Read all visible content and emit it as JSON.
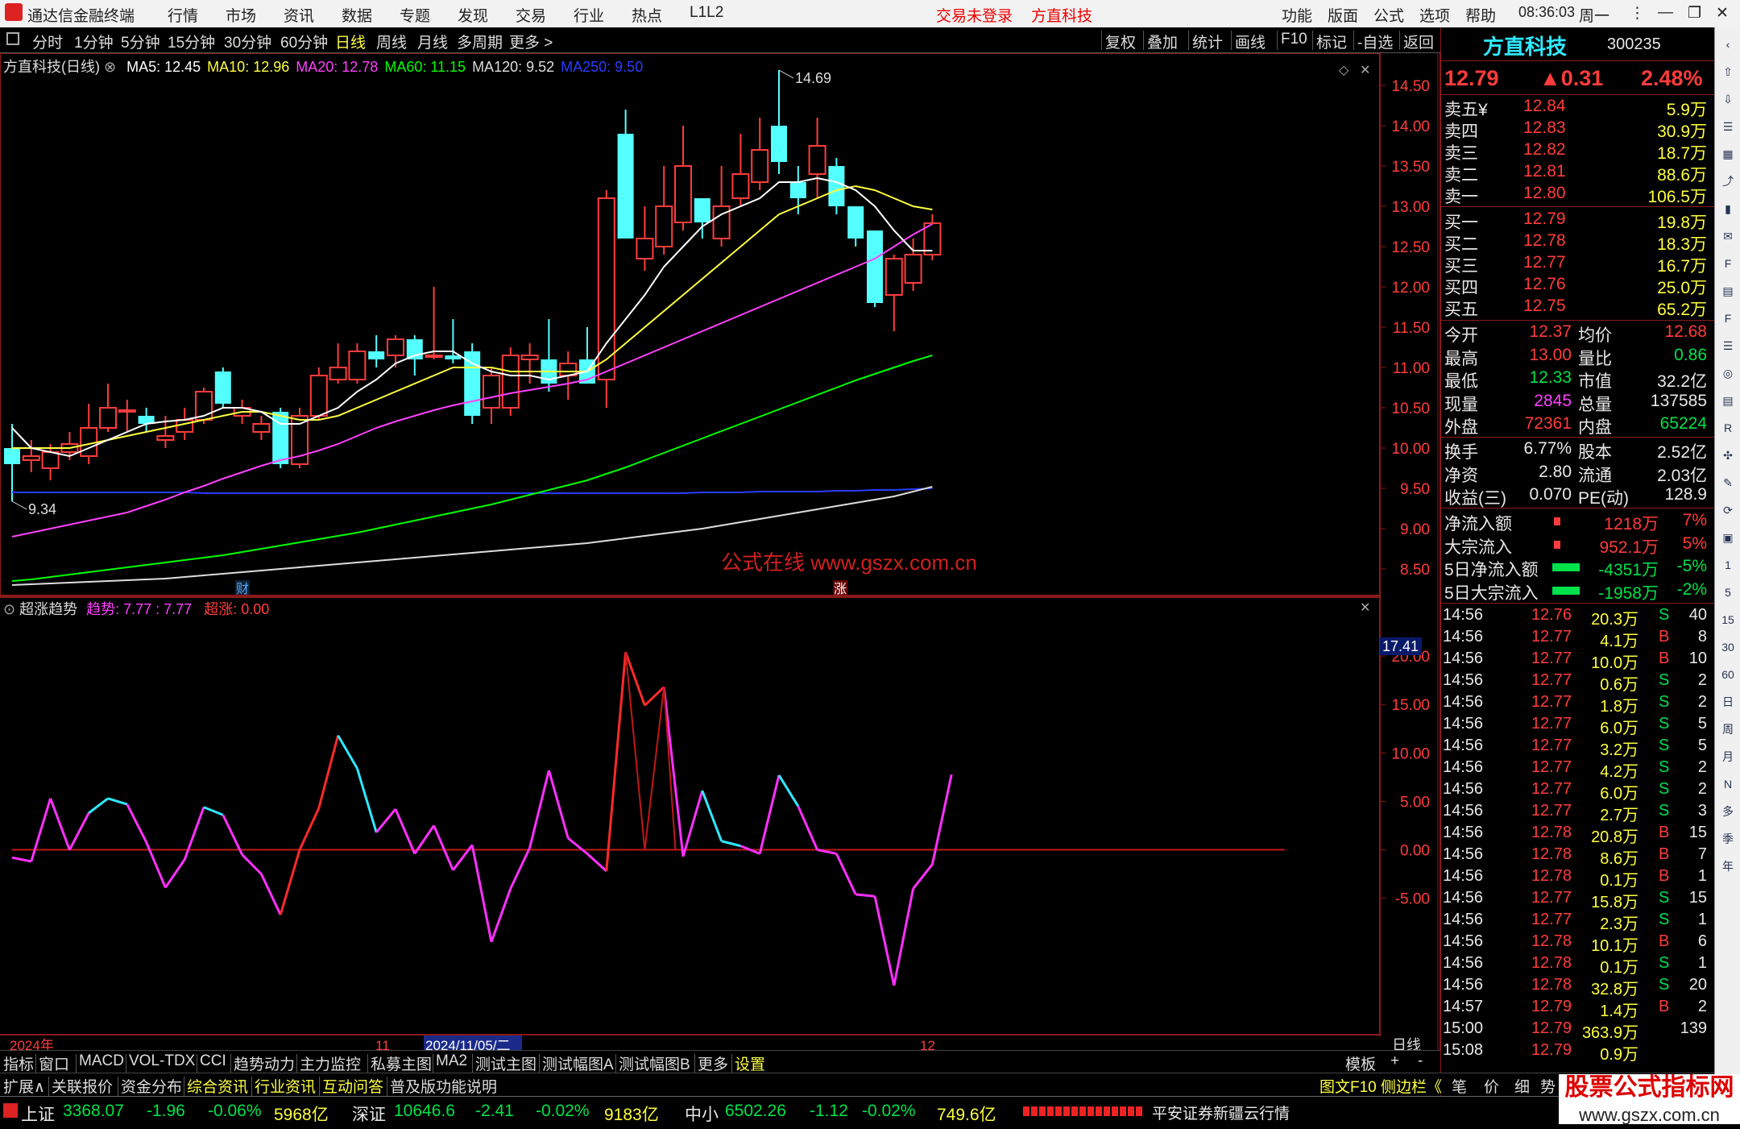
{
  "app": {
    "name": "通达信金融终端",
    "menu": [
      "行情",
      "市场",
      "资讯",
      "数据",
      "专题",
      "发现",
      "交易",
      "行业",
      "热点",
      "L1L2"
    ],
    "notice1": "交易未登录",
    "notice2": "方直科技",
    "right_menu": [
      "功能",
      "版面",
      "公式",
      "选项",
      "帮助"
    ],
    "time": "08:36:03",
    "weekday": "周一"
  },
  "toolbar": {
    "periods": [
      "分时",
      "1分钟",
      "5分钟",
      "15分钟",
      "30分钟",
      "60分钟",
      "日线",
      "周线",
      "月线",
      "多周期",
      "更多 >"
    ],
    "selected_period": "日线",
    "right": [
      "复权",
      "叠加",
      "统计",
      "画线",
      "F10",
      "标记",
      "-自选",
      "返回"
    ]
  },
  "chart": {
    "title": "方直科技(日线)",
    "ma_labels": [
      {
        "text": "MA5: 12.45",
        "color": "#ffffff"
      },
      {
        "text": "MA10: 12.96",
        "color": "#ffff40"
      },
      {
        "text": "MA20: 12.78",
        "color": "#ff40ff"
      },
      {
        "text": "MA60: 11.15",
        "color": "#00ff00"
      },
      {
        "text": "MA120: 9.52",
        "color": "#dddddd"
      },
      {
        "text": "MA250: 9.50",
        "color": "#2a3cff"
      }
    ],
    "high_label": "14.69",
    "low_label": "9.34",
    "marker_cai": "财",
    "marker_zhang": "涨",
    "watermark": "公式在线  www.gszx.com.cn",
    "price_axis": [
      "14.50",
      "14.00",
      "13.50",
      "13.00",
      "12.50",
      "12.00",
      "11.50",
      "11.00",
      "10.50",
      "10.00",
      "9.50",
      "9.00",
      "8.50"
    ],
    "ind_title": "超涨趋势",
    "ind_trend": "趋势: 7.77 : 7.77",
    "ind_over": "超涨: 0.00",
    "ind_axis": [
      "20.00",
      "15.00",
      "10.00",
      "5.00",
      "0.00",
      "-5.00"
    ],
    "ind_cur": "17.41",
    "date_axis": [
      "2024年",
      "11",
      "2024/11/05/二",
      "12"
    ],
    "period_tag": "日线"
  },
  "candles": [
    {
      "o": 10.0,
      "c": 9.8,
      "h": 10.3,
      "l": 9.34
    },
    {
      "o": 9.85,
      "c": 9.9,
      "h": 10.1,
      "l": 9.7
    },
    {
      "o": 9.75,
      "c": 9.95,
      "h": 10.05,
      "l": 9.6
    },
    {
      "o": 9.95,
      "c": 10.05,
      "h": 10.2,
      "l": 9.85
    },
    {
      "o": 9.9,
      "c": 10.25,
      "h": 10.55,
      "l": 9.8
    },
    {
      "o": 10.25,
      "c": 10.5,
      "h": 10.8,
      "l": 10.2
    },
    {
      "o": 10.45,
      "c": 10.47,
      "h": 10.6,
      "l": 10.2
    },
    {
      "o": 10.4,
      "c": 10.3,
      "h": 10.5,
      "l": 10.2
    },
    {
      "o": 10.1,
      "c": 10.15,
      "h": 10.4,
      "l": 10.0
    },
    {
      "o": 10.2,
      "c": 10.35,
      "h": 10.5,
      "l": 10.1
    },
    {
      "o": 10.35,
      "c": 10.7,
      "h": 10.75,
      "l": 10.3
    },
    {
      "o": 10.95,
      "c": 10.55,
      "h": 11.0,
      "l": 10.5
    },
    {
      "o": 10.4,
      "c": 10.5,
      "h": 10.6,
      "l": 10.3
    },
    {
      "o": 10.2,
      "c": 10.3,
      "h": 10.4,
      "l": 10.1
    },
    {
      "o": 10.45,
      "c": 9.8,
      "h": 10.5,
      "l": 9.75
    },
    {
      "o": 9.8,
      "c": 10.4,
      "h": 10.5,
      "l": 9.75
    },
    {
      "o": 10.4,
      "c": 10.9,
      "h": 11.0,
      "l": 10.35
    },
    {
      "o": 10.85,
      "c": 11.0,
      "h": 11.3,
      "l": 10.8
    },
    {
      "o": 10.85,
      "c": 11.2,
      "h": 11.3,
      "l": 10.8
    },
    {
      "o": 11.2,
      "c": 11.1,
      "h": 11.4,
      "l": 11.0
    },
    {
      "o": 11.15,
      "c": 11.35,
      "h": 11.4,
      "l": 11.0
    },
    {
      "o": 11.35,
      "c": 11.1,
      "h": 11.4,
      "l": 10.9
    },
    {
      "o": 11.15,
      "c": 11.15,
      "h": 12.0,
      "l": 11.1
    },
    {
      "o": 11.15,
      "c": 11.1,
      "h": 11.6,
      "l": 11.05
    },
    {
      "o": 11.2,
      "c": 10.4,
      "h": 11.3,
      "l": 10.3
    },
    {
      "o": 10.5,
      "c": 10.9,
      "h": 11.0,
      "l": 10.3
    },
    {
      "o": 10.5,
      "c": 11.15,
      "h": 11.25,
      "l": 10.4
    },
    {
      "o": 11.1,
      "c": 11.15,
      "h": 11.3,
      "l": 10.8
    },
    {
      "o": 11.1,
      "c": 10.8,
      "h": 11.6,
      "l": 10.7
    },
    {
      "o": 10.9,
      "c": 11.05,
      "h": 11.2,
      "l": 10.6
    },
    {
      "o": 11.1,
      "c": 10.8,
      "h": 11.5,
      "l": 10.8
    },
    {
      "o": 10.85,
      "c": 13.1,
      "h": 13.2,
      "l": 10.5
    },
    {
      "o": 13.9,
      "c": 12.6,
      "h": 14.2,
      "l": 12.6
    },
    {
      "o": 12.35,
      "c": 12.6,
      "h": 13.0,
      "l": 12.2
    },
    {
      "o": 12.5,
      "c": 13.0,
      "h": 13.5,
      "l": 12.4
    },
    {
      "o": 12.8,
      "c": 13.5,
      "h": 14.0,
      "l": 12.7
    },
    {
      "o": 13.1,
      "c": 12.8,
      "h": 13.1,
      "l": 12.6
    },
    {
      "o": 12.6,
      "c": 13.0,
      "h": 13.5,
      "l": 12.5
    },
    {
      "o": 13.1,
      "c": 13.4,
      "h": 13.9,
      "l": 13.0
    },
    {
      "o": 13.3,
      "c": 13.7,
      "h": 14.1,
      "l": 13.2
    },
    {
      "o": 14.0,
      "c": 13.55,
      "h": 14.69,
      "l": 13.4
    },
    {
      "o": 13.3,
      "c": 13.1,
      "h": 13.5,
      "l": 12.9
    },
    {
      "o": 13.4,
      "c": 13.75,
      "h": 14.1,
      "l": 13.1
    },
    {
      "o": 13.5,
      "c": 13.0,
      "h": 13.6,
      "l": 12.9
    },
    {
      "o": 13.0,
      "c": 12.6,
      "h": 13.0,
      "l": 12.5
    },
    {
      "o": 12.7,
      "c": 11.8,
      "h": 12.7,
      "l": 11.75
    },
    {
      "o": 11.9,
      "c": 12.35,
      "h": 12.4,
      "l": 11.45
    },
    {
      "o": 12.05,
      "c": 12.4,
      "h": 12.6,
      "l": 11.95
    },
    {
      "o": 12.4,
      "c": 12.79,
      "h": 12.9,
      "l": 12.33
    }
  ],
  "ma5": [
    10.25,
    10.0,
    9.95,
    9.9,
    10.0,
    10.1,
    10.2,
    10.3,
    10.33,
    10.35,
    10.4,
    10.5,
    10.5,
    10.45,
    10.3,
    10.3,
    10.4,
    10.5,
    10.7,
    10.85,
    11.05,
    11.15,
    11.2,
    11.2,
    11.05,
    10.95,
    10.9,
    10.9,
    10.85,
    10.9,
    10.95,
    11.3,
    11.6,
    11.9,
    12.25,
    12.5,
    12.75,
    12.9,
    13.0,
    13.1,
    13.3,
    13.3,
    13.35,
    13.3,
    13.2,
    13.0,
    12.7,
    12.45,
    12.45
  ],
  "ma10": [
    10.0,
    10.0,
    10.0,
    10.0,
    10.05,
    10.1,
    10.15,
    10.2,
    10.25,
    10.3,
    10.35,
    10.4,
    10.45,
    10.45,
    10.4,
    10.35,
    10.35,
    10.4,
    10.5,
    10.6,
    10.7,
    10.8,
    10.9,
    11.0,
    11.0,
    11.0,
    10.95,
    10.95,
    10.95,
    10.95,
    10.95,
    11.1,
    11.3,
    11.5,
    11.7,
    11.9,
    12.1,
    12.3,
    12.5,
    12.7,
    12.9,
    13.0,
    13.1,
    13.2,
    13.25,
    13.2,
    13.1,
    13.0,
    12.96
  ],
  "ma20": [
    8.9,
    8.95,
    9.0,
    9.05,
    9.1,
    9.15,
    9.2,
    9.28,
    9.36,
    9.45,
    9.53,
    9.62,
    9.7,
    9.78,
    9.85,
    9.9,
    9.97,
    10.05,
    10.15,
    10.25,
    10.33,
    10.4,
    10.47,
    10.53,
    10.58,
    10.63,
    10.68,
    10.72,
    10.76,
    10.8,
    10.85,
    10.95,
    11.05,
    11.15,
    11.25,
    11.35,
    11.45,
    11.55,
    11.65,
    11.75,
    11.85,
    11.95,
    12.05,
    12.15,
    12.25,
    12.35,
    12.5,
    12.65,
    12.78
  ],
  "ma60": [
    8.35,
    8.37,
    8.4,
    8.43,
    8.46,
    8.49,
    8.52,
    8.55,
    8.58,
    8.61,
    8.64,
    8.67,
    8.71,
    8.75,
    8.79,
    8.83,
    8.87,
    8.91,
    8.95,
    9.0,
    9.05,
    9.1,
    9.15,
    9.2,
    9.25,
    9.3,
    9.36,
    9.42,
    9.48,
    9.54,
    9.6,
    9.68,
    9.76,
    9.85,
    9.94,
    10.03,
    10.12,
    10.21,
    10.3,
    10.39,
    10.48,
    10.57,
    10.66,
    10.75,
    10.84,
    10.92,
    11.0,
    11.08,
    11.15
  ],
  "ma120": [
    8.3,
    8.31,
    8.32,
    8.33,
    8.34,
    8.35,
    8.36,
    8.37,
    8.38,
    8.4,
    8.42,
    8.44,
    8.46,
    8.48,
    8.5,
    8.52,
    8.54,
    8.56,
    8.58,
    8.6,
    8.62,
    8.64,
    8.66,
    8.68,
    8.7,
    8.72,
    8.74,
    8.76,
    8.78,
    8.8,
    8.82,
    8.85,
    8.88,
    8.91,
    8.94,
    8.97,
    9.0,
    9.04,
    9.08,
    9.12,
    9.16,
    9.2,
    9.24,
    9.28,
    9.32,
    9.36,
    9.4,
    9.46,
    9.52
  ],
  "ma250": [
    9.45,
    9.45,
    9.45,
    9.45,
    9.45,
    9.45,
    9.45,
    9.45,
    9.45,
    9.45,
    9.44,
    9.44,
    9.44,
    9.44,
    9.44,
    9.44,
    9.44,
    9.44,
    9.44,
    9.44,
    9.44,
    9.44,
    9.44,
    9.44,
    9.44,
    9.44,
    9.44,
    9.44,
    9.44,
    9.44,
    9.44,
    9.44,
    9.44,
    9.44,
    9.44,
    9.44,
    9.45,
    9.45,
    9.45,
    9.46,
    9.46,
    9.46,
    9.46,
    9.47,
    9.47,
    9.48,
    9.48,
    9.49,
    9.5
  ],
  "indicator": [
    -0.8,
    -1.2,
    5.3,
    0.0,
    3.8,
    5.3,
    4.7,
    0.8,
    -3.9,
    -1.0,
    4.4,
    3.6,
    -0.5,
    -2.5,
    -6.7,
    0.0,
    4.3,
    11.8,
    8.4,
    1.8,
    4.2,
    -0.4,
    2.5,
    -2.1,
    0.5,
    -9.5,
    -4.0,
    0.2,
    8.2,
    1.2,
    -0.4,
    -2.2,
    20.4,
    14.9,
    16.8,
    -0.7,
    6.1,
    0.9,
    0.4,
    -0.4,
    7.7,
    4.5,
    0.0,
    -0.4,
    -4.6,
    -4.8,
    -14.0,
    -4.0,
    -1.5,
    7.77
  ],
  "indicator_colors": [
    "m",
    "m",
    "m",
    "m",
    "m",
    "c",
    "c",
    "m",
    "m",
    "m",
    "m",
    "c",
    "m",
    "m",
    "m",
    "r",
    "r",
    "r",
    "c",
    "c",
    "m",
    "m",
    "m",
    "m",
    "m",
    "m",
    "m",
    "m",
    "m",
    "m",
    "m",
    "m",
    "r",
    "r",
    "r",
    "m",
    "m",
    "c",
    "c",
    "m",
    "m",
    "c",
    "m",
    "m",
    "m",
    "m",
    "m",
    "m",
    "m",
    "m"
  ],
  "quote": {
    "name": "方直科技",
    "code": "300235",
    "price": "12.79",
    "change": "▲0.31",
    "pct": "2.48%",
    "asks": [
      {
        "l": "卖五¥",
        "p": "12.84",
        "v": "5.9万"
      },
      {
        "l": "卖四",
        "p": "12.83",
        "v": "30.9万"
      },
      {
        "l": "卖三",
        "p": "12.82",
        "v": "18.7万"
      },
      {
        "l": "卖二",
        "p": "12.81",
        "v": "88.6万"
      },
      {
        "l": "卖一",
        "p": "12.80",
        "v": "106.5万"
      }
    ],
    "bids": [
      {
        "l": "买一",
        "p": "12.79",
        "v": "19.8万"
      },
      {
        "l": "买二",
        "p": "12.78",
        "v": "18.3万"
      },
      {
        "l": "买三",
        "p": "12.77",
        "v": "16.7万"
      },
      {
        "l": "买四",
        "p": "12.76",
        "v": "25.0万"
      },
      {
        "l": "买五",
        "p": "12.75",
        "v": "65.2万"
      }
    ],
    "stats": [
      {
        "l1": "今开",
        "v1": "12.37",
        "c1": "r",
        "l2": "均价",
        "v2": "12.68",
        "c2": "r"
      },
      {
        "l1": "最高",
        "v1": "13.00",
        "c1": "r",
        "l2": "量比",
        "v2": "0.86",
        "c2": "g"
      },
      {
        "l1": "最低",
        "v1": "12.33",
        "c1": "g",
        "l2": "市值",
        "v2": "32.2亿",
        "c2": "w"
      },
      {
        "l1": "现量",
        "v1": "2845",
        "c1": "m",
        "l2": "总量",
        "v2": "137585",
        "c2": "w"
      },
      {
        "l1": "外盘",
        "v1": "72361",
        "c1": "r",
        "l2": "内盘",
        "v2": "65224",
        "c2": "g"
      }
    ],
    "stats2": [
      {
        "l1": "换手",
        "v1": "6.77%",
        "c1": "w",
        "l2": "股本",
        "v2": "2.52亿",
        "c2": "w"
      },
      {
        "l1": "净资",
        "v1": "2.80",
        "c1": "w",
        "l2": "流通",
        "v2": "2.03亿",
        "c2": "w"
      },
      {
        "l1": "收益(三)",
        "v1": "0.070",
        "c1": "w",
        "l2": "PE(动)",
        "v2": "128.9",
        "c2": "w"
      }
    ],
    "flows": [
      {
        "l": "净流入额",
        "v": "1218万",
        "p": "7%",
        "c": "r"
      },
      {
        "l": "大宗流入",
        "v": "952.1万",
        "p": "5%",
        "c": "r"
      },
      {
        "l": "5日净流入额",
        "v": "-4351万",
        "p": "-5%",
        "c": "g"
      },
      {
        "l": "5日大宗流入",
        "v": "-1958万",
        "p": "-2%",
        "c": "g"
      }
    ],
    "ticks": [
      {
        "t": "14:56",
        "p": "12.76",
        "v": "20.3万",
        "s": "S",
        "n": "40"
      },
      {
        "t": "14:56",
        "p": "12.77",
        "v": "4.1万",
        "s": "B",
        "n": "8"
      },
      {
        "t": "14:56",
        "p": "12.77",
        "v": "10.0万",
        "s": "B",
        "n": "10"
      },
      {
        "t": "14:56",
        "p": "12.77",
        "v": "0.6万",
        "s": "S",
        "n": "2"
      },
      {
        "t": "14:56",
        "p": "12.77",
        "v": "1.8万",
        "s": "S",
        "n": "2"
      },
      {
        "t": "14:56",
        "p": "12.77",
        "v": "6.0万",
        "s": "S",
        "n": "5"
      },
      {
        "t": "14:56",
        "p": "12.77",
        "v": "3.2万",
        "s": "S",
        "n": "5"
      },
      {
        "t": "14:56",
        "p": "12.77",
        "v": "4.2万",
        "s": "S",
        "n": "2"
      },
      {
        "t": "14:56",
        "p": "12.77",
        "v": "6.0万",
        "s": "S",
        "n": "2"
      },
      {
        "t": "14:56",
        "p": "12.77",
        "v": "2.7万",
        "s": "S",
        "n": "3"
      },
      {
        "t": "14:56",
        "p": "12.78",
        "v": "20.8万",
        "s": "B",
        "n": "15"
      },
      {
        "t": "14:56",
        "p": "12.78",
        "v": "8.6万",
        "s": "B",
        "n": "7"
      },
      {
        "t": "14:56",
        "p": "12.78",
        "v": "0.1万",
        "s": "B",
        "n": "1"
      },
      {
        "t": "14:56",
        "p": "12.77",
        "v": "15.8万",
        "s": "S",
        "n": "15"
      },
      {
        "t": "14:56",
        "p": "12.77",
        "v": "2.3万",
        "s": "S",
        "n": "1"
      },
      {
        "t": "14:56",
        "p": "12.78",
        "v": "10.1万",
        "s": "B",
        "n": "6"
      },
      {
        "t": "14:56",
        "p": "12.78",
        "v": "0.1万",
        "s": "S",
        "n": "1"
      },
      {
        "t": "14:56",
        "p": "12.78",
        "v": "32.8万",
        "s": "S",
        "n": "20"
      },
      {
        "t": "14:57",
        "p": "12.79",
        "v": "1.4万",
        "s": "B",
        "n": "2"
      },
      {
        "t": "15:00",
        "p": "12.79",
        "v": "363.9万",
        "s": "",
        "n": "139"
      },
      {
        "t": "15:08",
        "p": "12.79",
        "v": "0.9万",
        "s": "",
        "n": ""
      }
    ]
  },
  "bottom_tabs": [
    "指标",
    "窗口",
    "MACD",
    "VOL-TDX",
    "CCI",
    "趋势动力",
    "主力监控",
    "私募主图",
    "MA2",
    "测试主图",
    "测试幅图A",
    "测试幅图B",
    "更多",
    "设置"
  ],
  "bottom_right": [
    "模板",
    "+",
    "-"
  ],
  "sub_tabs": [
    "扩展∧",
    "关联报价",
    "资金分布",
    "综合资讯",
    "行业资讯",
    "互动问答",
    "普及版功能说明"
  ],
  "sub_right": [
    "图文F10",
    "侧边栏《",
    "笔",
    "价",
    "细",
    "势"
  ],
  "status": {
    "sh_label": "上证",
    "sh": "3368.07",
    "sh_chg": "-1.96",
    "sh_pct": "-0.06%",
    "sh_amt": "5968亿",
    "sz_label": "深证",
    "sz": "10646.6",
    "sz_chg": "-2.41",
    "sz_pct": "-0.02%",
    "sz_amt": "9183亿",
    "zx_label": "中小",
    "zx": "6502.26",
    "zx_chg": "-1.12",
    "zx_pct": "-0.02%",
    "zx_amt": "749.6亿",
    "broker": "平安证券新疆云行情"
  },
  "logo_watermark": {
    "line1": "股票公式指标网",
    "line2": "www.gszx.com.cn"
  },
  "colors": {
    "up": "#ff3c3c",
    "down": "#54ffff",
    "bg": "#000000",
    "grid": "#8a1a1a"
  }
}
